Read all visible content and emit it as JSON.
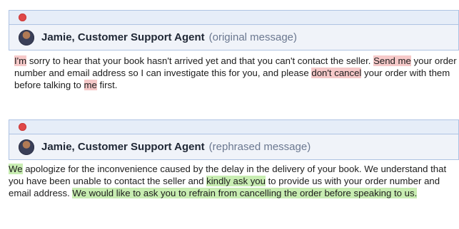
{
  "colors": {
    "red_highlight": "#f6c9c9",
    "green_highlight": "#c8edb2",
    "header_border": "#aec3e3",
    "dot": "#e04848"
  },
  "icons": {
    "status": "red-dot-icon",
    "avatar": "agent-avatar-icon"
  },
  "original": {
    "agent_name": "Jamie, Customer Support Agent",
    "label": "(original message)",
    "segments": [
      {
        "text": "I'm",
        "hl": "red"
      },
      {
        "text": " sorry to hear that your book hasn't arrived yet and that you can't contact the seller. ",
        "hl": ""
      },
      {
        "text": "Send me",
        "hl": "red"
      },
      {
        "text": " your order number and email address so I can investigate this for you, and please ",
        "hl": ""
      },
      {
        "text": "don't cancel",
        "hl": "red"
      },
      {
        "text": " your order with them before talking to ",
        "hl": ""
      },
      {
        "text": "me",
        "hl": "red"
      },
      {
        "text": " first.",
        "hl": ""
      }
    ]
  },
  "rephrased": {
    "agent_name": "Jamie, Customer Support Agent",
    "label": "(rephrased message)",
    "segments": [
      {
        "text": "We",
        "hl": "green"
      },
      {
        "text": " apologize for the inconvenience caused by the delay in the delivery of your book. We understand that you have been unable to contact the seller and ",
        "hl": ""
      },
      {
        "text": "kindly ask you",
        "hl": "green"
      },
      {
        "text": " to provide us with your order number and email address. ",
        "hl": ""
      },
      {
        "text": "We would like to ask you to refrain from cancelling the order before speaking to us.",
        "hl": "green"
      }
    ]
  }
}
